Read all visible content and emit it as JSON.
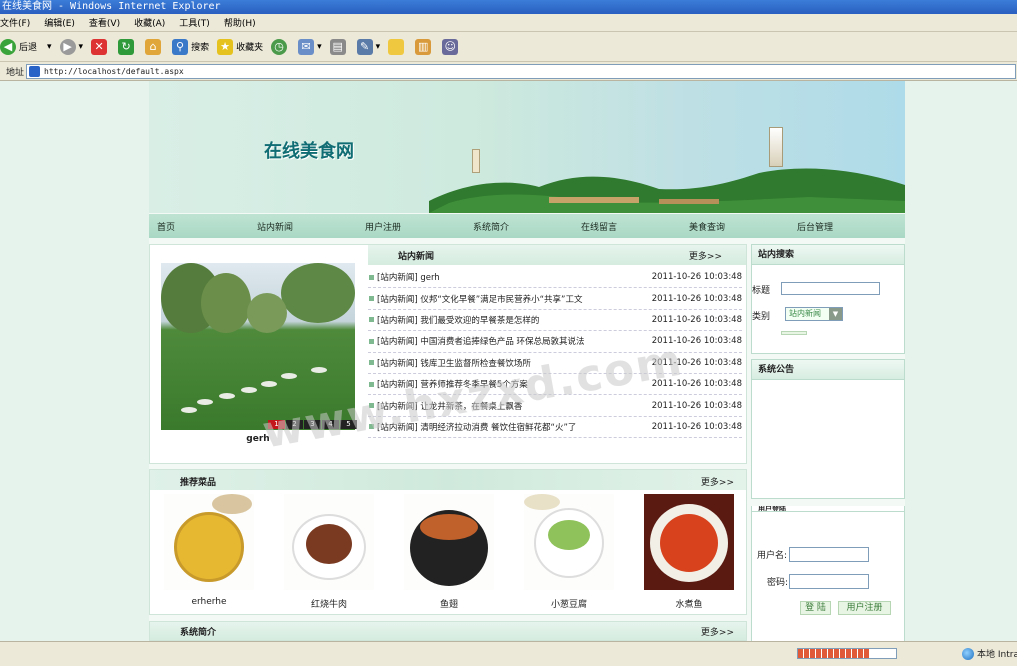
{
  "window": {
    "title": "在线美食网 - Windows Internet Explorer"
  },
  "menu": [
    "文件(F)",
    "编辑(E)",
    "查看(V)",
    "收藏(A)",
    "工具(T)",
    "帮助(H)"
  ],
  "toolbar": {
    "back_label": "后退",
    "search_label": "搜索",
    "favorites_label": "收藏夹"
  },
  "address": {
    "label": "地址",
    "url": "http://localhost/default.aspx"
  },
  "site": {
    "title": "在线美食网",
    "nav": [
      "首页",
      "站内新闻",
      "用户注册",
      "系统简介",
      "在线留言",
      "美食查询",
      "后台管理"
    ],
    "news": {
      "heading": "站内新闻",
      "more": "更多>>",
      "photo_caption": "gerh",
      "pager": [
        "1",
        "2",
        "3",
        "4",
        "5"
      ],
      "items": [
        {
          "title": "[站内新闻] gerh",
          "date": "2011-10-26 10:03:48"
        },
        {
          "title": "[站内新闻] 仪邦“文化早餐”满足市民营养小“共享”工文",
          "date": "2011-10-26 10:03:48"
        },
        {
          "title": "[站内新闻] 我们最受欢迎的早餐茶是怎样的",
          "date": "2011-10-26 10:03:48"
        },
        {
          "title": "[站内新闻] 中国消费者追捧绿色产品 环保总局敦其说法",
          "date": "2011-10-26 10:03:48"
        },
        {
          "title": "[站内新闻] 钱库卫生监督所检查餐饮场所",
          "date": "2011-10-26 10:03:48"
        },
        {
          "title": "[站内新闻] 营养师推荐冬季早餐5个方案",
          "date": "2011-10-26 10:03:48"
        },
        {
          "title": "[站内新闻] 让龙井新茶，在餐桌上飘香",
          "date": "2011-10-26 10:03:48"
        },
        {
          "title": "[站内新闻] 清明经济拉动消费 餐饮住宿鲜花都“火”了",
          "date": "2011-10-26 10:03:48"
        }
      ]
    },
    "dishes": {
      "heading": "推荐菜品",
      "more": "更多>>",
      "items": [
        {
          "name": "erherhe"
        },
        {
          "name": "红烧牛肉"
        },
        {
          "name": "鱼翅"
        },
        {
          "name": "小葱豆腐"
        },
        {
          "name": "水煮鱼"
        }
      ]
    },
    "system_intro": {
      "heading": "系统简介",
      "more": "更多>>"
    },
    "search": {
      "heading": "站内搜索",
      "keyword_label": "标题",
      "category_label": "类别",
      "category_value": "站内新闻"
    },
    "notice": {
      "heading": "系统公告"
    },
    "login": {
      "heading": "用户登陆",
      "username_label": "用户名:",
      "password_label": "密码:",
      "login_button": "登 陆",
      "register_button": "用户注册"
    }
  },
  "watermark": "www.hxzxd.com",
  "status": {
    "zone": "本地 Intranet"
  },
  "colors": {
    "nav_bg": "#a9d8c5",
    "title": "#0f6d73",
    "active_page": "#c4171b"
  }
}
